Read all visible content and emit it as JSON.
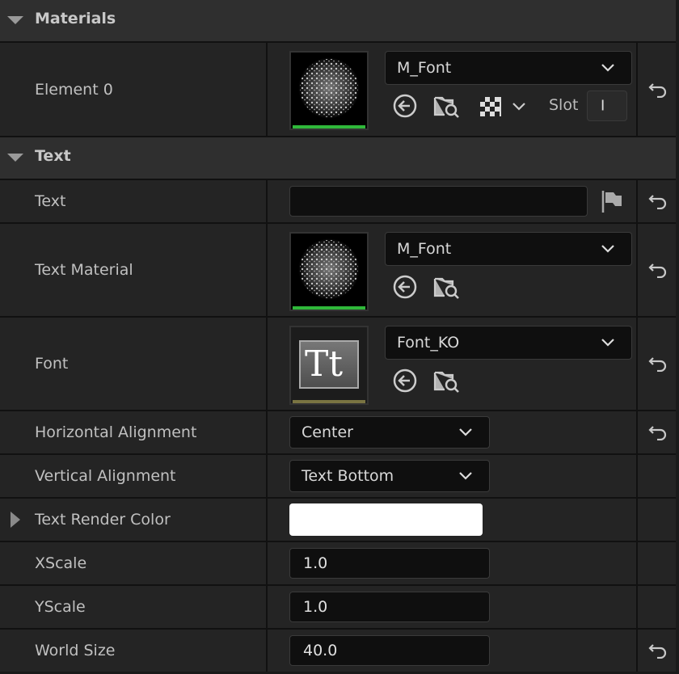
{
  "sections": {
    "materials": {
      "label": "Materials"
    },
    "text": {
      "label": "Text"
    }
  },
  "rows": {
    "element0": {
      "label": "Element 0",
      "material_value": "M_Font",
      "slot_label": "Slot",
      "slot_value": "I"
    },
    "text": {
      "label": "Text",
      "value": ""
    },
    "text_material": {
      "label": "Text Material",
      "material_value": "M_Font"
    },
    "font": {
      "label": "Font",
      "font_value": "Font_KO",
      "thumb_text": "Tt"
    },
    "horizontal_alignment": {
      "label": "Horizontal Alignment",
      "value": "Center"
    },
    "vertical_alignment": {
      "label": "Vertical Alignment",
      "value": "Text Bottom"
    },
    "text_render_color": {
      "label": "Text Render Color",
      "color": "#ffffff"
    },
    "xscale": {
      "label": "XScale",
      "value": "1.0"
    },
    "yscale": {
      "label": "YScale",
      "value": "1.0"
    },
    "world_size": {
      "label": "World Size",
      "value": "40.0"
    }
  },
  "colors": {
    "material_bar": "#2fb83a",
    "font_bar": "#7a7442"
  },
  "icons": {
    "use_selected": "arrow-left-circle-icon",
    "browse": "folder-search-icon",
    "checker": "checkerboard-icon",
    "reset": "reset-arrow-icon",
    "flag": "localization-flag-icon"
  }
}
